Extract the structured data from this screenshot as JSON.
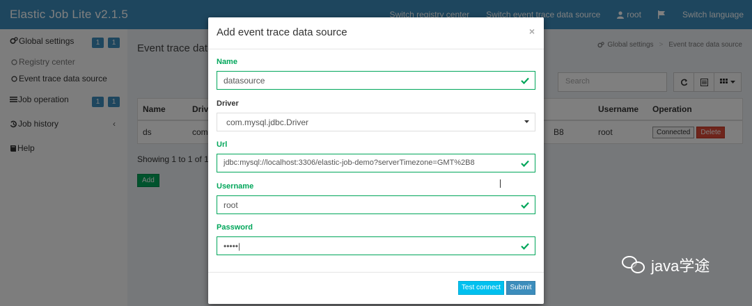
{
  "app": {
    "brand": "Elastic Job Lite v2.1.5"
  },
  "topnav": {
    "switch_registry": "Switch registry center",
    "switch_event_trace": "Switch event trace data source",
    "user": "root",
    "flag_icon": "flag-icon",
    "switch_language": "Switch language"
  },
  "sidebar": {
    "global_settings": {
      "label": "Global settings",
      "badges": [
        "1",
        "1"
      ]
    },
    "registry_center": "Registry center",
    "event_trace": "Event trace data source",
    "job_operation": {
      "label": "Job operation",
      "badges": [
        "1",
        "1"
      ]
    },
    "job_history": "Job history",
    "job_history_chevron": "‹",
    "help": "Help"
  },
  "content": {
    "page_title": "Event trace dat",
    "breadcrumb": {
      "home": "Global settings",
      "current": "Event trace data source"
    },
    "search": {
      "placeholder": "Search"
    },
    "table": {
      "columns": [
        "Name",
        "Driv",
        "",
        "Username",
        "Operation"
      ],
      "rows": [
        {
          "name": "ds",
          "driver": "com",
          "url": "B8",
          "username": "root",
          "connected": "Connected",
          "delete": "Delete"
        }
      ]
    },
    "showing": "Showing 1 to 1 of 1 r",
    "add_label": "Add"
  },
  "modal": {
    "title": "Add event trace data source",
    "close": "×",
    "fields": {
      "name": {
        "label": "Name",
        "value": "datasource"
      },
      "driver": {
        "label": "Driver",
        "value": "com.mysql.jdbc.Driver"
      },
      "url": {
        "label": "Url",
        "value": "jdbc:mysql://localhost:3306/elastic-job-demo?serverTimezone=GMT%2B8"
      },
      "username": {
        "label": "Username",
        "value": "root"
      },
      "password": {
        "label": "Password",
        "value": "•••••|"
      }
    },
    "test_connect": "Test connect",
    "submit": "Submit"
  },
  "watermark": {
    "text": "java学途"
  },
  "colors": {
    "primary": "#3c8dbc",
    "success": "#00a65a",
    "danger": "#dd4b39",
    "info": "#00c0ef"
  }
}
